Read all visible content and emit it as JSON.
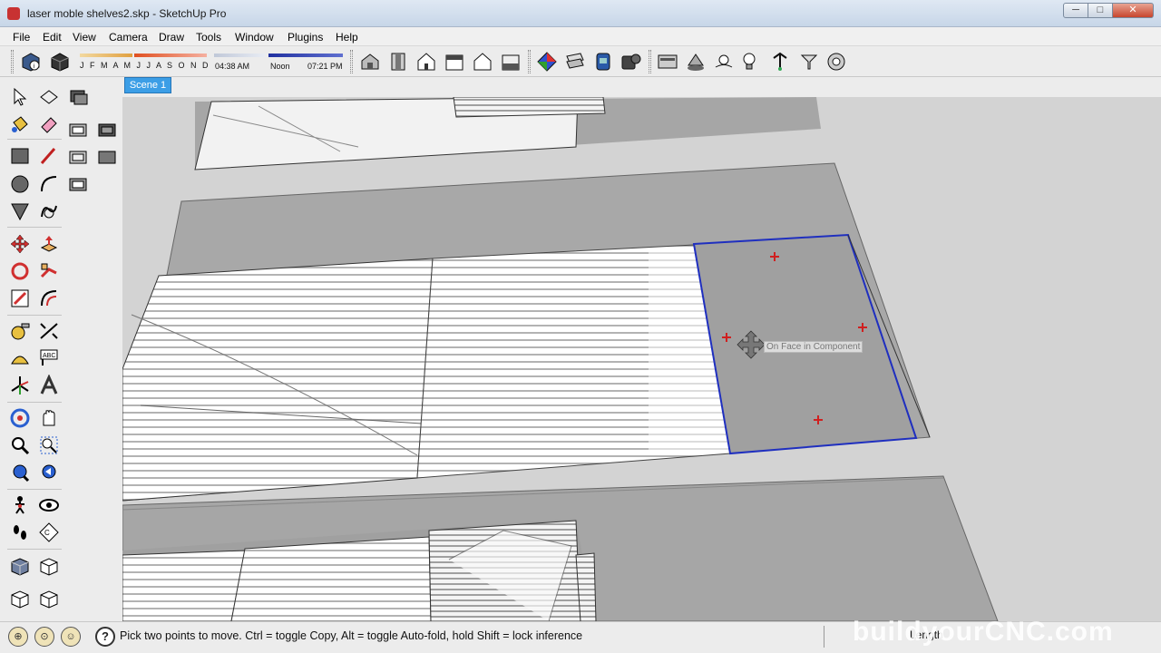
{
  "window": {
    "title": "laser moble shelves2.skp - SketchUp Pro",
    "min_glyph": "─",
    "max_glyph": "□",
    "close_glyph": "✕"
  },
  "menu": [
    "File",
    "Edit",
    "View",
    "Camera",
    "Draw",
    "Tools",
    "Window",
    "Plugins",
    "Help"
  ],
  "shadows": {
    "months": "J F M A M J J A S O N D",
    "time_start": "04:38 AM",
    "time_mid": "Noon",
    "time_end": "07:21 PM"
  },
  "scene": {
    "tab_label": "Scene 1"
  },
  "viewport": {
    "inference_tooltip": "On Face in Component"
  },
  "status": {
    "help_glyph": "?",
    "message": "Pick two points to move.  Ctrl = toggle Copy, Alt = toggle Auto-fold, hold Shift = lock inference",
    "vcb_label": "Length"
  },
  "watermark": "buildyourCNC.com",
  "icons": {
    "toolbar": [
      "model-info-icon",
      "component-icon",
      "iso-view-icon",
      "top-view-icon",
      "front-view-icon",
      "right-view-icon",
      "back-view-icon",
      "left-view-icon",
      "materials-icon",
      "styles-icon",
      "layers-icon",
      "outliner-icon",
      "scenes-icon",
      "shadows-icon",
      "fog-icon",
      "soften-icon",
      "sandbox-icon",
      "smoove-icon",
      "settings-icon"
    ],
    "left": [
      "select-icon",
      "make-component-icon",
      "paint-bucket-icon",
      "eraser-icon",
      "rectangle-icon",
      "line-icon",
      "circle-icon",
      "arc-icon",
      "polygon-icon",
      "freehand-icon",
      "move-icon",
      "push-pull-icon",
      "rotate-icon",
      "follow-me-icon",
      "scale-icon",
      "offset-icon",
      "tape-measure-icon",
      "dimension-icon",
      "protractor-icon",
      "text-icon",
      "axes-icon",
      "3d-text-icon",
      "orbit-icon",
      "pan-icon",
      "zoom-icon",
      "zoom-window-icon",
      "zoom-extents-icon",
      "previous-view-icon",
      "walk-icon",
      "look-around-icon",
      "footprints-icon",
      "section-plane-icon"
    ]
  },
  "colors": {
    "selection": "#1f2fbf",
    "scene_tab": "#3c9ee6",
    "face_gray": "#a0a0a0"
  }
}
